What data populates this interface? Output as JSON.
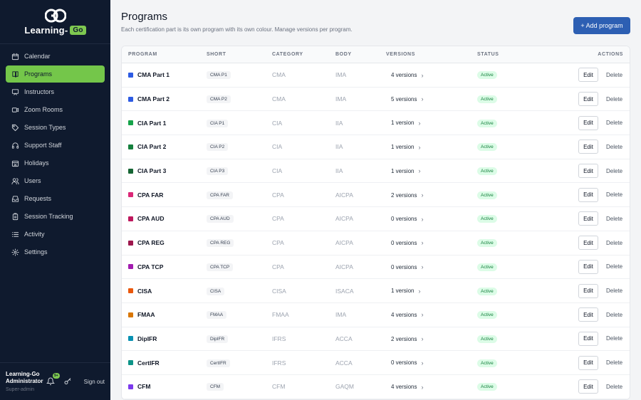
{
  "brand": {
    "name": "Learning-",
    "badge": "Go",
    "brand_color": "#74c64a"
  },
  "sidebar": {
    "items": [
      {
        "label": "Calendar",
        "icon": "calendar-icon",
        "active": false
      },
      {
        "label": "Programs",
        "icon": "book-icon",
        "active": true
      },
      {
        "label": "Instructors",
        "icon": "chalkboard-icon",
        "active": false
      },
      {
        "label": "Zoom Rooms",
        "icon": "video-icon",
        "active": false
      },
      {
        "label": "Session Types",
        "icon": "tag-icon",
        "active": false
      },
      {
        "label": "Support Staff",
        "icon": "headset-icon",
        "active": false
      },
      {
        "label": "Holidays",
        "icon": "calendar-off-icon",
        "active": false
      },
      {
        "label": "Users",
        "icon": "users-icon",
        "active": false
      },
      {
        "label": "Requests",
        "icon": "inbox-icon",
        "active": false
      },
      {
        "label": "Session Tracking",
        "icon": "clipboard-icon",
        "active": false
      },
      {
        "label": "Activity",
        "icon": "list-icon",
        "active": false
      },
      {
        "label": "Settings",
        "icon": "gear-icon",
        "active": false
      }
    ]
  },
  "footer": {
    "user_name_line1": "Learning-Go",
    "user_name_line2": "Administrator",
    "user_role": "Super-admin",
    "notif_count": "9+",
    "sign_out": "Sign out"
  },
  "header": {
    "title": "Programs",
    "subtitle": "Each certification part is its own program with its own colour. Manage versions per program.",
    "add_button": "+ Add program"
  },
  "table": {
    "columns": [
      "Program",
      "Short",
      "Category",
      "Body",
      "Versions",
      "Status",
      "Actions"
    ],
    "edit_label": "Edit",
    "delete_label": "Delete",
    "rows": [
      {
        "name": "CMA Part 1",
        "short": "CMA P1",
        "category": "CMA",
        "body": "IMA",
        "versions": "4 versions",
        "status": "Active",
        "color": "#2d5be3"
      },
      {
        "name": "CMA Part 2",
        "short": "CMA P2",
        "category": "CMA",
        "body": "IMA",
        "versions": "5 versions",
        "status": "Active",
        "color": "#2d5be3"
      },
      {
        "name": "CIA Part 1",
        "short": "CIA P1",
        "category": "CIA",
        "body": "IIA",
        "versions": "1 version",
        "status": "Active",
        "color": "#16a34a"
      },
      {
        "name": "CIA Part 2",
        "short": "CIA P2",
        "category": "CIA",
        "body": "IIA",
        "versions": "1 version",
        "status": "Active",
        "color": "#15803d"
      },
      {
        "name": "CIA Part 3",
        "short": "CIA P3",
        "category": "CIA",
        "body": "IIA",
        "versions": "1 version",
        "status": "Active",
        "color": "#166534"
      },
      {
        "name": "CPA FAR",
        "short": "CPA FAR",
        "category": "CPA",
        "body": "AICPA",
        "versions": "2 versions",
        "status": "Active",
        "color": "#db2777"
      },
      {
        "name": "CPA AUD",
        "short": "CPA AUD",
        "category": "CPA",
        "body": "AICPA",
        "versions": "0 versions",
        "status": "Active",
        "color": "#be185d"
      },
      {
        "name": "CPA REG",
        "short": "CPA REG",
        "category": "CPA",
        "body": "AICPA",
        "versions": "0 versions",
        "status": "Active",
        "color": "#9d174d"
      },
      {
        "name": "CPA TCP",
        "short": "CPA TCP",
        "category": "CPA",
        "body": "AICPA",
        "versions": "0 versions",
        "status": "Active",
        "color": "#a21caf"
      },
      {
        "name": "CISA",
        "short": "CISA",
        "category": "CISA",
        "body": "ISACA",
        "versions": "1 version",
        "status": "Active",
        "color": "#ea580c"
      },
      {
        "name": "FMAA",
        "short": "FMAA",
        "category": "FMAA",
        "body": "IMA",
        "versions": "4 versions",
        "status": "Active",
        "color": "#d97706"
      },
      {
        "name": "DipIFR",
        "short": "DipIFR",
        "category": "IFRS",
        "body": "ACCA",
        "versions": "2 versions",
        "status": "Active",
        "color": "#0891b2"
      },
      {
        "name": "CertIFR",
        "short": "CertIFR",
        "category": "IFRS",
        "body": "ACCA",
        "versions": "0 versions",
        "status": "Active",
        "color": "#0d9488"
      },
      {
        "name": "CFM",
        "short": "CFM",
        "category": "CFM",
        "body": "GAQM",
        "versions": "4 versions",
        "status": "Active",
        "color": "#7c3aed"
      }
    ]
  }
}
